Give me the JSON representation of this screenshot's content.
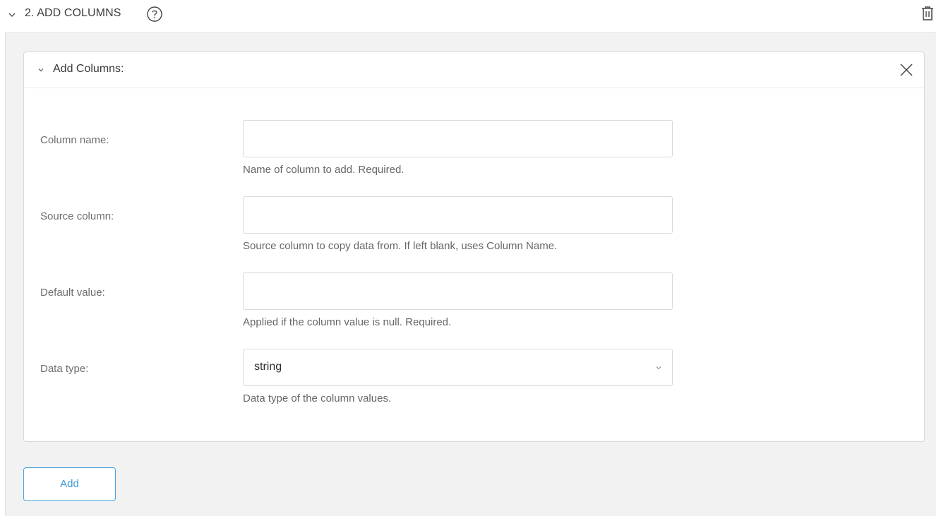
{
  "section": {
    "title": "2. ADD COLUMNS",
    "icons": {
      "collapse": "chevron-down-icon",
      "help": "help-icon",
      "delete": "trash-icon"
    }
  },
  "card": {
    "title": "Add Columns:",
    "icons": {
      "collapse": "chevron-down-icon",
      "close": "close-icon"
    },
    "fields": [
      {
        "label": "Column name:",
        "value": "",
        "hint": "Name of column to add. Required."
      },
      {
        "label": "Source column:",
        "value": "",
        "hint": "Source column to copy data from. If left blank, uses Column Name."
      },
      {
        "label": "Default value:",
        "value": "",
        "hint": "Applied if the column value is null. Required."
      },
      {
        "label": "Data type:",
        "value": "string",
        "hint": "Data type of the column values."
      }
    ]
  },
  "actions": {
    "add_label": "Add"
  },
  "colors": {
    "accent": "#3d9ad6",
    "panel_bg": "#f2f2f2",
    "border": "#d9d9d9"
  }
}
